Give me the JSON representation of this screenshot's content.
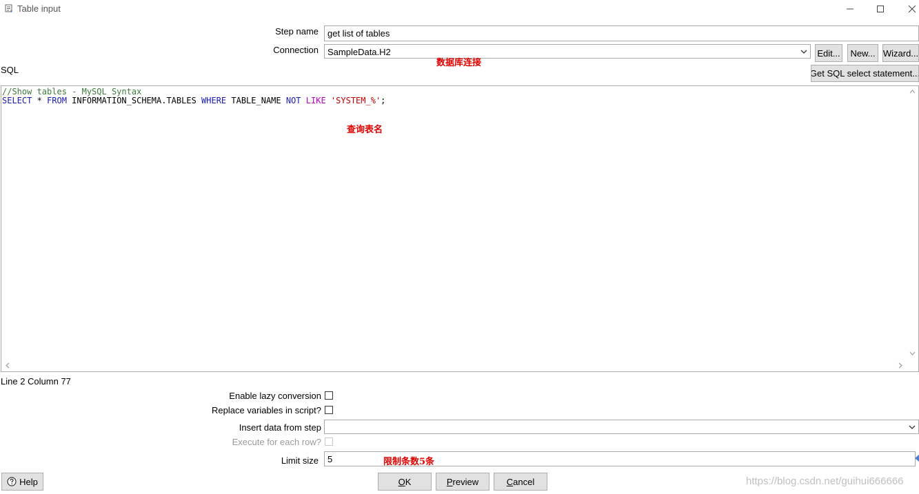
{
  "window": {
    "title": "Table input",
    "icon": "table-input-icon",
    "controls": [
      "minimize-icon",
      "maximize-icon",
      "close-icon"
    ]
  },
  "step_name": {
    "label": "Step name",
    "value": "get list of tables"
  },
  "connection": {
    "label": "Connection",
    "value": "SampleData.H2",
    "annotation": "数据库连接",
    "edit_label": "Edit...",
    "new_label": "New...",
    "wizard_label": "Wizard..."
  },
  "sql": {
    "label": "SQL",
    "get_sql_label": "Get SQL select statement...",
    "comment_line": "//Show tables - MySQL Syntax",
    "line2": {
      "kw_select": "SELECT",
      "star": " * ",
      "kw_from": "FROM",
      "table": " INFORMATION_SCHEMA.TABLES ",
      "kw_where": "WHERE",
      "col": " TABLE_NAME ",
      "kw_not": "NOT",
      "space": " ",
      "kw_like": "LIKE",
      "space2": " ",
      "str": "'SYSTEM_%'",
      "semi": ";"
    },
    "annotation": "查询表名",
    "status": "Line 2 Column 77"
  },
  "options": {
    "lazy_conversion": {
      "label": "Enable lazy conversion",
      "checked": false
    },
    "replace_variables": {
      "label": "Replace variables in script?",
      "checked": false
    },
    "insert_data": {
      "label": "Insert data from step",
      "value": ""
    },
    "execute_each_row": {
      "label": "Execute for each row?",
      "checked": false,
      "disabled": true
    },
    "limit_size": {
      "label": "Limit size",
      "value": "5",
      "annotation": "限制条数5条"
    }
  },
  "buttons": {
    "help": "Help",
    "ok": {
      "mnemonic": "O",
      "rest": "K"
    },
    "preview": {
      "mnemonic": "P",
      "rest": "review"
    },
    "cancel": {
      "mnemonic": "C",
      "rest": "ancel"
    }
  },
  "watermark": "https://blog.csdn.net/guihui666666",
  "colors": {
    "annotation": "#e00000",
    "keyword": "#1a1ab4",
    "comment": "#3c7a3c",
    "like": "#c000c0",
    "string": "#c00000"
  }
}
